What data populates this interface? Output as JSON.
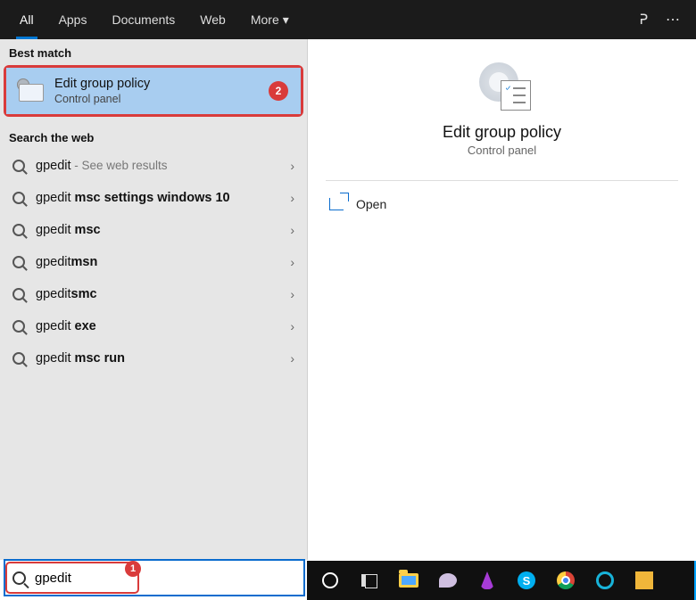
{
  "tabs": {
    "all": "All",
    "apps": "Apps",
    "documents": "Documents",
    "web": "Web",
    "more": "More"
  },
  "sections": {
    "best_match": "Best match",
    "search_web": "Search the web"
  },
  "best_match": {
    "title": "Edit group policy",
    "subtitle": "Control panel",
    "badge": "2"
  },
  "web_results": [
    {
      "prefix": "gpedit",
      "bold": "",
      "suffix": " - See web results"
    },
    {
      "prefix": "gpedit ",
      "bold": "msc settings windows 10",
      "suffix": ""
    },
    {
      "prefix": "gpedit ",
      "bold": "msc",
      "suffix": ""
    },
    {
      "prefix": "gpedit",
      "bold": "msn",
      "suffix": ""
    },
    {
      "prefix": "gpedit",
      "bold": "smc",
      "suffix": ""
    },
    {
      "prefix": "gpedit ",
      "bold": "exe",
      "suffix": ""
    },
    {
      "prefix": "gpedit ",
      "bold": "msc run",
      "suffix": ""
    }
  ],
  "detail": {
    "title": "Edit group policy",
    "subtitle": "Control panel",
    "actions": {
      "open": "Open"
    }
  },
  "search": {
    "value": "gpedit",
    "badge": "1"
  },
  "taskbar_icons": [
    "cortana",
    "taskview",
    "file-explorer",
    "snip",
    "flame",
    "skype",
    "chrome",
    "oo",
    "note"
  ],
  "skype_letter": "S"
}
